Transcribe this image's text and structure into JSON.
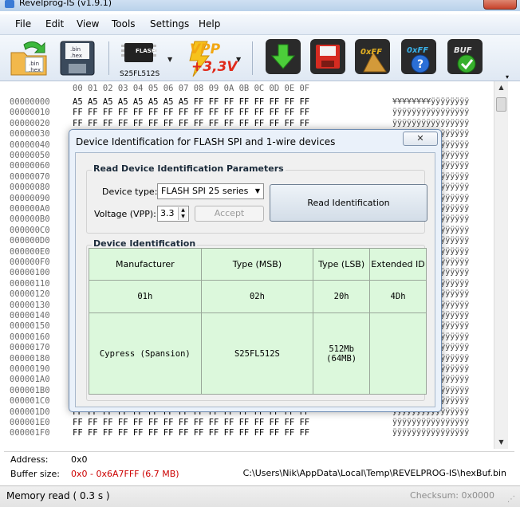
{
  "window": {
    "title": "Revelprog-IS (v1.9.1)"
  },
  "menu": [
    "File",
    "Edit",
    "View",
    "Tools",
    "Settings",
    "Help"
  ],
  "toolbar": {
    "open_icon_text": ".bin .hex",
    "save_icon_text": ".bin .hex",
    "chip_icon_text": "FLASH",
    "chip_name": "S25FL512S",
    "vpp_text": "VPP",
    "vpp_value": "+3,3V",
    "erase_label": "0xFF",
    "blank_label": "0xFF",
    "buf_label": "BUF"
  },
  "hex": {
    "header": "00 01 02 03 04 05 06 07 08 09 0A 0B 0C 0D 0E 0F",
    "first_row_bytes": "A5 A5 A5 A5 A5 A5 A5 A5 FF FF FF FF FF FF FF FF",
    "first_row_ascii": "¥¥¥¥¥¥¥¥ÿÿÿÿÿÿÿÿ",
    "ff_row_bytes": "FF FF FF FF FF FF FF FF FF FF FF FF FF FF FF FF",
    "ff_row_ascii": "ÿÿÿÿÿÿÿÿÿÿÿÿÿÿÿÿ",
    "addresses": [
      "00000000",
      "00000010",
      "00000020",
      "00000030",
      "00000040",
      "00000050",
      "00000060",
      "00000070",
      "00000080",
      "00000090",
      "000000A0",
      "000000B0",
      "000000C0",
      "000000D0",
      "000000E0",
      "000000F0",
      "00000100",
      "00000110",
      "00000120",
      "00000130",
      "00000140",
      "00000150",
      "00000160",
      "00000170",
      "00000180",
      "00000190",
      "000001A0",
      "000001B0",
      "000001C0",
      "000001D0",
      "000001E0",
      "000001F0"
    ]
  },
  "info": {
    "address_label": "Address:",
    "address_value": "0x0",
    "buffer_label": "Buffer size:",
    "buffer_value": "0x0 - 0x6A7FFF (6.7 MB)",
    "buffer_path": "C:\\Users\\Nik\\AppData\\Local\\Temp\\REVELPROG-IS\\hexBuf.bin",
    "buffer_color": "#cc0000"
  },
  "status": {
    "left": "Memory read ( 0.3 s )",
    "checksum": "Checksum: 0x0000"
  },
  "dialog": {
    "title": "Device Identification for FLASH SPI and 1-wire devices",
    "close": "✕",
    "params_group": "Read Device Identification Parameters",
    "device_type_label": "Device type:",
    "device_type_value": "FLASH SPI 25 series",
    "voltage_label": "Voltage (VPP):",
    "voltage_value": "3.3",
    "accept_label": "Accept",
    "read_label": "Read Identification",
    "id_group": "Device Identification",
    "table": {
      "headers": [
        "Manufacturer",
        "Type (MSB)",
        "Type (LSB)",
        "Extended ID"
      ],
      "row1": [
        "01h",
        "02h",
        "20h",
        "4Dh"
      ],
      "row2": [
        "Cypress (Spansion)",
        "S25FL512S",
        "512Mb",
        "(64MB)",
        ""
      ]
    }
  }
}
